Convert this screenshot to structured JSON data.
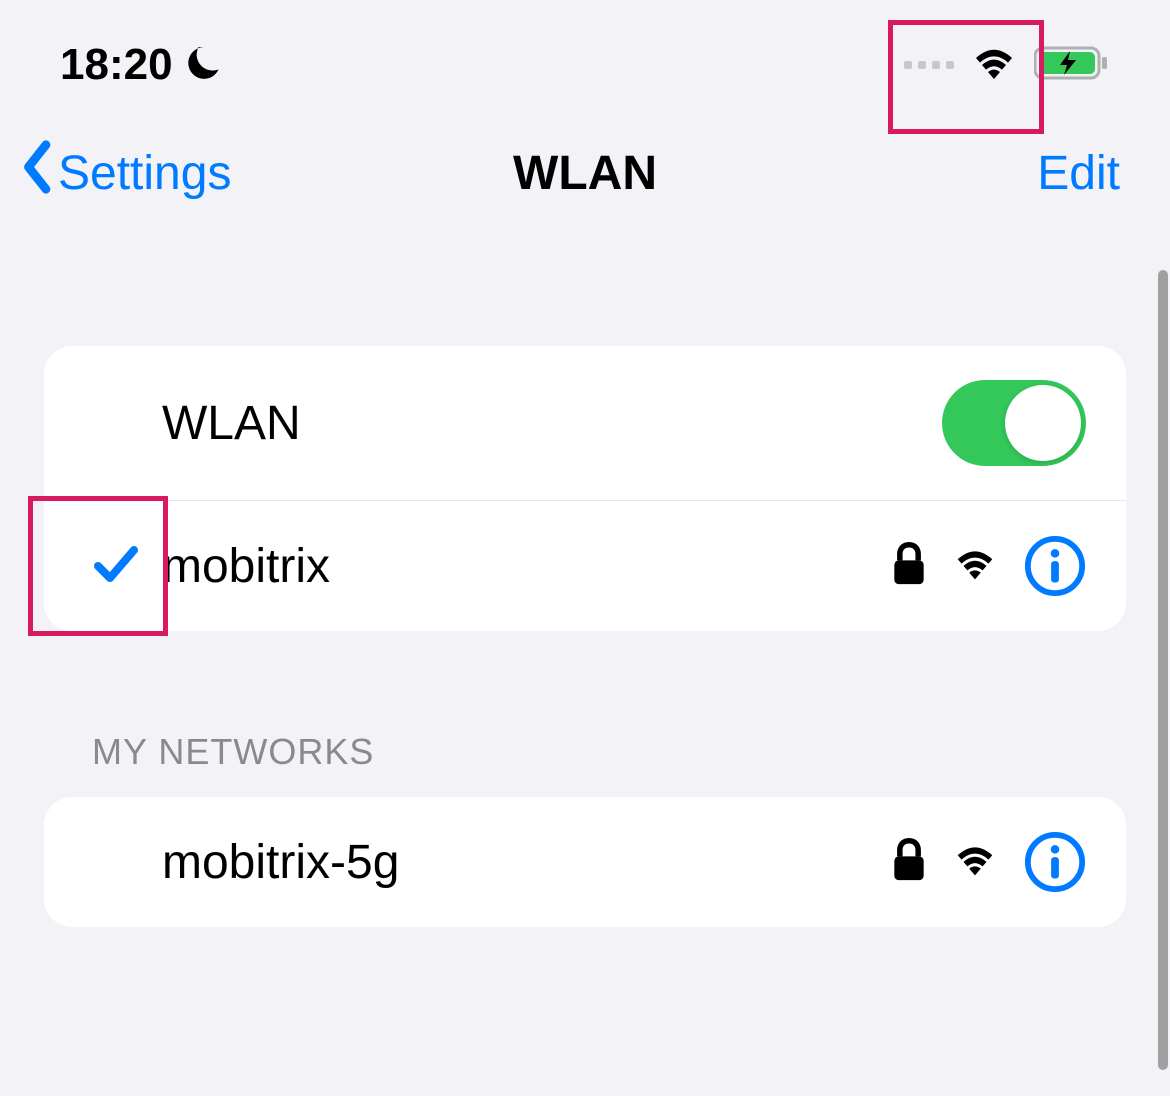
{
  "statusBar": {
    "time": "18:20"
  },
  "nav": {
    "backLabel": "Settings",
    "title": "WLAN",
    "editLabel": "Edit"
  },
  "wlanToggle": {
    "label": "WLAN",
    "on": true
  },
  "connectedNetwork": {
    "name": "mobitrix",
    "secured": true
  },
  "sections": {
    "myNetworks": {
      "header": "MY NETWORKS",
      "items": [
        {
          "name": "mobitrix-5g",
          "secured": true
        }
      ]
    }
  }
}
